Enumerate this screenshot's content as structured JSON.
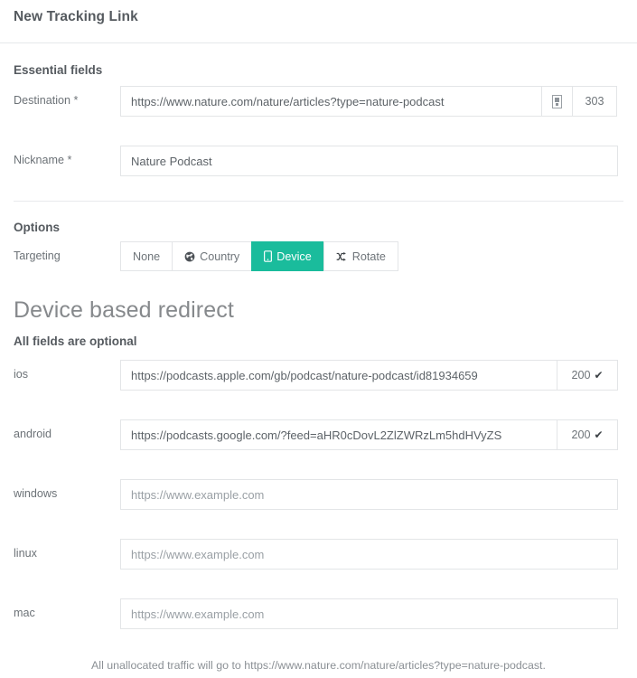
{
  "header": {
    "title": "New Tracking Link"
  },
  "essential": {
    "section_label": "Essential fields",
    "destination": {
      "label": "Destination *",
      "value": "https://www.nature.com/nature/articles?type=nature-podcast",
      "icon": "save-glyph-icon",
      "status_code": "303"
    },
    "nickname": {
      "label": "Nickname *",
      "value": "Nature Podcast"
    }
  },
  "options": {
    "section_label": "Options",
    "targeting": {
      "label": "Targeting",
      "buttons": [
        {
          "label": "None",
          "icon": "",
          "active": false
        },
        {
          "label": "Country",
          "icon": "globe-icon",
          "active": false
        },
        {
          "label": "Device",
          "icon": "mobile-icon",
          "active": true
        },
        {
          "label": "Rotate",
          "icon": "shuffle-icon",
          "active": false
        }
      ]
    }
  },
  "device_redirect": {
    "heading": "Device based redirect",
    "subheading": "All fields are optional",
    "rows": [
      {
        "label": "ios",
        "value": "https://podcasts.apple.com/gb/podcast/nature-podcast/id81934659",
        "placeholder": "",
        "status_code": "200",
        "status_ok": true
      },
      {
        "label": "android",
        "value": "https://podcasts.google.com/?feed=aHR0cDovL2ZlZWRzLm5hdHVyZS",
        "placeholder": "",
        "status_code": "200",
        "status_ok": true
      },
      {
        "label": "windows",
        "value": "",
        "placeholder": "https://www.example.com",
        "status_code": "",
        "status_ok": false
      },
      {
        "label": "linux",
        "value": "",
        "placeholder": "https://www.example.com",
        "status_code": "",
        "status_ok": false
      },
      {
        "label": "mac",
        "value": "",
        "placeholder": "https://www.example.com",
        "status_code": "",
        "status_ok": false
      }
    ]
  },
  "footer": {
    "note": "All unallocated traffic will go to https://www.nature.com/nature/articles?type=nature-podcast."
  },
  "colors": {
    "accent": "#1abc9c",
    "border": "#e3e5e7",
    "text": "#6c7277"
  }
}
